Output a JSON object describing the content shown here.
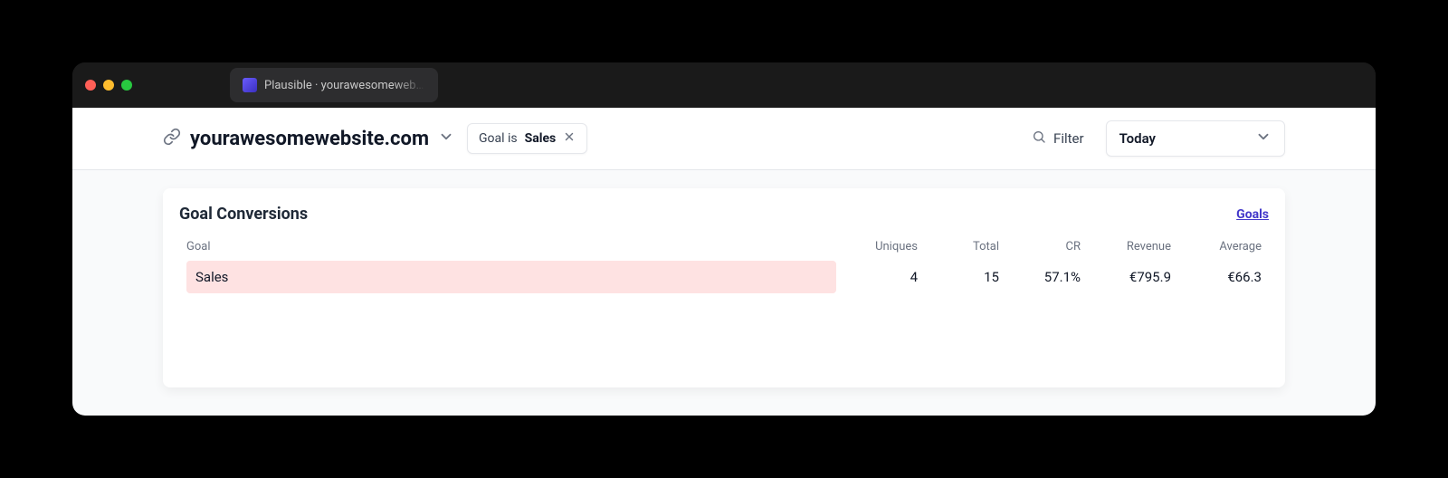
{
  "browser": {
    "tab_title": "Plausible · yourawesomewebsite"
  },
  "header": {
    "site_name": "yourawesomewebsite.com",
    "filter_chip": {
      "prefix": "Goal is ",
      "value": "Sales"
    },
    "filter_button_label": "Filter",
    "period_label": "Today"
  },
  "card": {
    "title": "Goal Conversions",
    "goals_link_label": "Goals",
    "columns": {
      "goal": "Goal",
      "uniques": "Uniques",
      "total": "Total",
      "cr": "CR",
      "revenue": "Revenue",
      "average": "Average"
    },
    "rows": [
      {
        "goal": "Sales",
        "uniques": "4",
        "total": "15",
        "cr": "57.1%",
        "revenue": "€795.9",
        "average": "€66.3"
      }
    ]
  }
}
